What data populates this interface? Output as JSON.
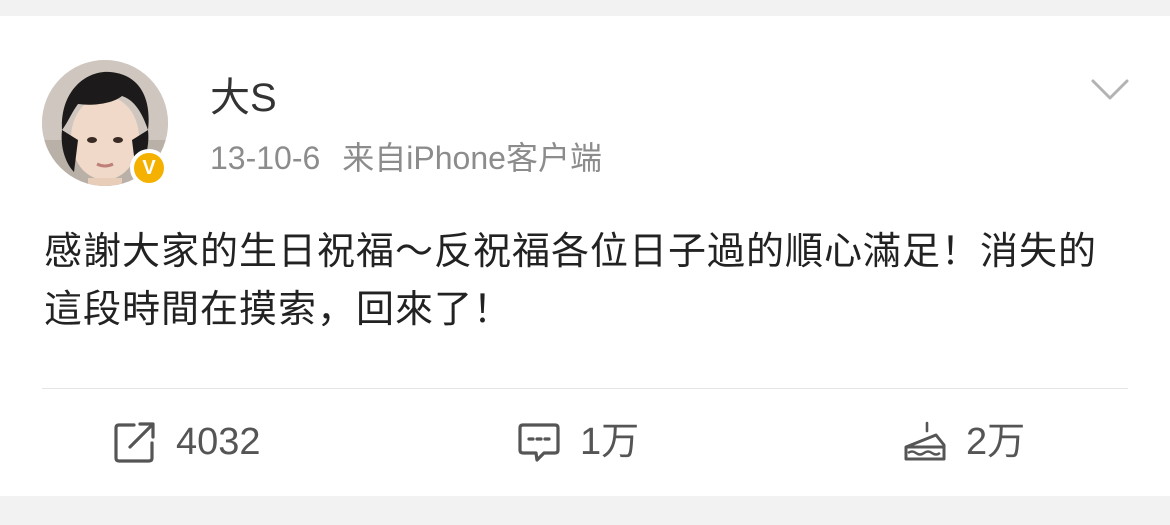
{
  "post": {
    "username": "大S",
    "date": "13-10-6",
    "source": "来自iPhone客户端",
    "verified_badge": "V",
    "text": "感謝大家的生日祝福～反祝福各位日子過的順心滿足！消失的這段時間在摸索，回來了！"
  },
  "actions": {
    "repost_count": "4032",
    "comment_count": "1万",
    "like_count": "2万"
  },
  "icons": {
    "menu": "chevron-down-icon",
    "repost": "repost-icon",
    "comment": "comment-icon",
    "like": "cake-like-icon"
  },
  "colors": {
    "background": "#f2f2f2",
    "card": "#ffffff",
    "verified": "#f5b100",
    "meta_text": "#8c8c8c",
    "body_text": "#222222"
  }
}
